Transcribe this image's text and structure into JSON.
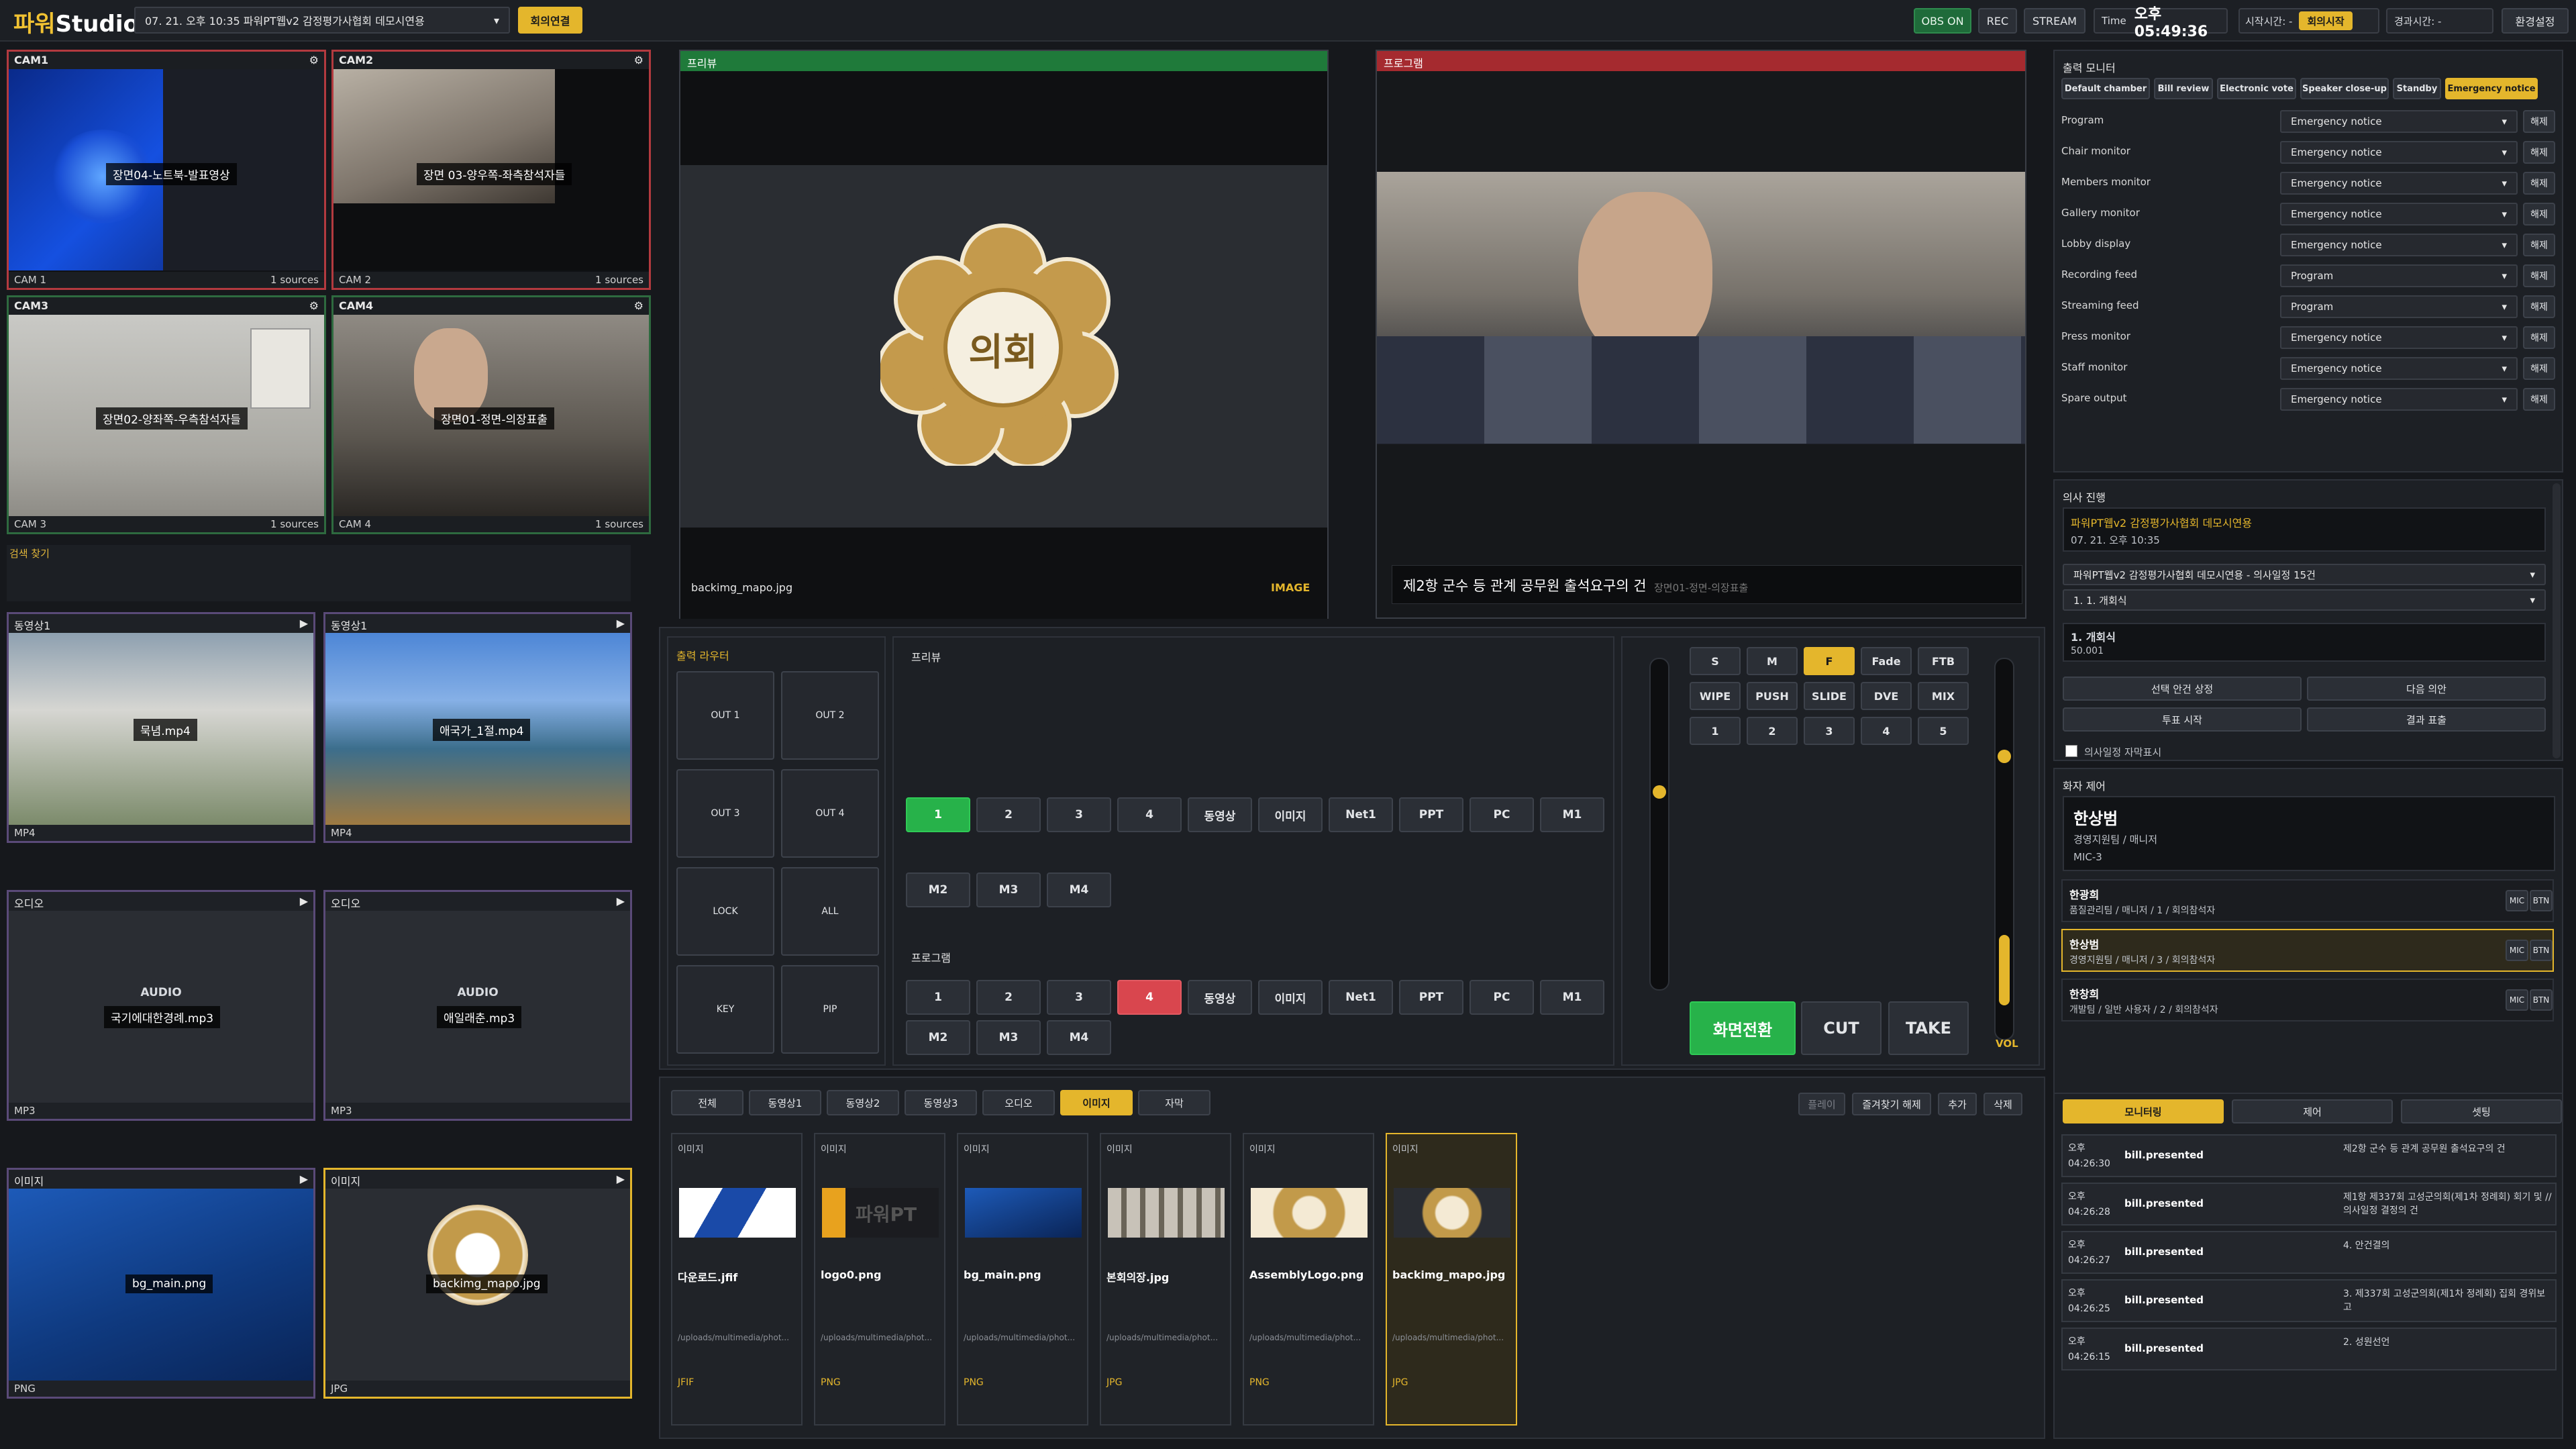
{
  "app": {
    "logo_a": "파워",
    "logo_b": "Studio"
  },
  "topbar": {
    "meeting_select": "07. 21. 오후 10:35 파워PT웹v2 감정평가사협회 데모시연용",
    "connect_button": "회의연결",
    "obs": "OBS ON",
    "rec": "REC",
    "stream": "STREAM",
    "time_label": "Time",
    "time_value": "오후 05:49:36",
    "start_label": "시작시간: -",
    "start_button": "회의시작",
    "elapsed": "경과시간: -",
    "settings": "환경설정"
  },
  "cams": [
    {
      "title": "CAM1",
      "label": "장면04-노트북-발표영상",
      "footer": "CAM 1",
      "sources": "1 sources"
    },
    {
      "title": "CAM2",
      "label": "장면 03-양우쪽-좌측참석자들",
      "footer": "CAM 2",
      "sources": "1 sources"
    },
    {
      "title": "CAM3",
      "label": "장면02-양좌쪽-우측참석자들",
      "footer": "CAM 3",
      "sources": "1 sources"
    },
    {
      "title": "CAM4",
      "label": "장면01-정면-의장표출",
      "footer": "CAM 4",
      "sources": "1 sources"
    }
  ],
  "search_label": "검색 찾기",
  "media_tiles": [
    {
      "head": "동영상1",
      "label": "묵념.mp4",
      "foot": "MP4"
    },
    {
      "head": "동영상1",
      "label": "애국가_1절.mp4",
      "foot": "MP4"
    },
    {
      "head": "오디오",
      "kind": "AUDIO",
      "label": "국기에대한경례.mp3",
      "foot": "MP3"
    },
    {
      "head": "오디오",
      "kind": "AUDIO",
      "label": "애일래춘.mp3",
      "foot": "MP3"
    },
    {
      "head": "이미지",
      "label": "bg_main.png",
      "foot": "PNG"
    },
    {
      "head": "이미지",
      "label": "backimg_mapo.jpg",
      "foot": "JPG"
    }
  ],
  "preview": {
    "title": "프리뷰",
    "emblem_text": "의회",
    "file": "backimg_mapo.jpg",
    "type": "IMAGE"
  },
  "program": {
    "title": "프로그램",
    "caption": "제2항 군수 등 관계 공무원 출석요구의 건",
    "subcaption": "장면01-정면-의장표출"
  },
  "router": {
    "title": "출력 라우터",
    "buttons": [
      "OUT 1",
      "OUT 2",
      "OUT 3",
      "OUT 4",
      "LOCK",
      "ALL",
      "KEY",
      "PIP"
    ]
  },
  "switcher": {
    "preview_label": "프리뷰",
    "program_label": "프로그램",
    "row1": [
      "1",
      "2",
      "3",
      "4",
      "동영상",
      "이미지",
      "Net1",
      "PPT",
      "PC",
      "M1"
    ],
    "row2": [
      "M2",
      "M3",
      "M4"
    ],
    "preview_active": "1",
    "program_active": "4"
  },
  "transition": {
    "row1": [
      "S",
      "M",
      "F",
      "Fade",
      "FTB"
    ],
    "row2": [
      "WIPE",
      "PUSH",
      "SLIDE",
      "DVE",
      "MIX"
    ],
    "row3": [
      "1",
      "2",
      "3",
      "4",
      "5"
    ],
    "active": "F",
    "switch": "화면전환",
    "cut": "CUT",
    "take": "TAKE",
    "vol": "VOL",
    "tbar_level": 0.6,
    "vol_level": 0.75
  },
  "library": {
    "tabs": [
      "전체",
      "동영상1",
      "동영상2",
      "동영상3",
      "오디오",
      "이미지",
      "자막"
    ],
    "active_tab": "이미지",
    "actions": [
      "플레이",
      "즐겨찾기 해제",
      "추가",
      "삭제"
    ],
    "items": [
      {
        "type": "이미지",
        "name": "다운로드.jfif",
        "path": "/uploads/multimedia/phot...",
        "ext": "JFIF"
      },
      {
        "type": "이미지",
        "name": "logo0.png",
        "path": "/uploads/multimedia/phot...",
        "ext": "PNG",
        "logo_text": "파워PT"
      },
      {
        "type": "이미지",
        "name": "bg_main.png",
        "path": "/uploads/multimedia/phot...",
        "ext": "PNG"
      },
      {
        "type": "이미지",
        "name": "본회의장.jpg",
        "path": "/uploads/multimedia/phot...",
        "ext": "JPG"
      },
      {
        "type": "이미지",
        "name": "AssemblyLogo.png",
        "path": "/uploads/multimedia/phot...",
        "ext": "PNG"
      },
      {
        "type": "이미지",
        "name": "backimg_mapo.jpg",
        "path": "/uploads/multimedia/phot...",
        "ext": "JPG"
      }
    ]
  },
  "output_monitor": {
    "title": "출력 모니터",
    "presets": [
      "Default chamber",
      "Bill review",
      "Electronic vote",
      "Speaker close-up",
      "Standby",
      "Emergency notice"
    ],
    "active_preset": "Emergency notice",
    "release": "해제",
    "rows": [
      {
        "name": "Program",
        "value": "Emergency notice"
      },
      {
        "name": "Chair monitor",
        "value": "Emergency notice"
      },
      {
        "name": "Members monitor",
        "value": "Emergency notice"
      },
      {
        "name": "Gallery monitor",
        "value": "Emergency notice"
      },
      {
        "name": "Lobby display",
        "value": "Emergency notice"
      },
      {
        "name": "Recording feed",
        "value": "Program"
      },
      {
        "name": "Streaming feed",
        "value": "Program"
      },
      {
        "name": "Press monitor",
        "value": "Emergency notice"
      },
      {
        "name": "Staff monitor",
        "value": "Emergency notice"
      },
      {
        "name": "Spare output",
        "value": "Emergency notice"
      }
    ]
  },
  "agenda": {
    "title": "의사 진행",
    "meeting_name": "파워PT웹v2 감정평가사협회 데모시연용",
    "meeting_date": "07. 21. 오후 10:35",
    "session_select": "파워PT웹v2 감정평가사협회 데모시연용 - 의사일정 15건",
    "item_select": "1. 1. 개회식",
    "current_title": "1. 개회식",
    "current_code": "50.001",
    "buttons": [
      "선택 안건 상정",
      "다음 의안",
      "투표 시작",
      "결과 표출"
    ],
    "checkbox_label": "의사일정 자막표시"
  },
  "speakers": {
    "title": "화자 제어",
    "main_name": "한상범",
    "main_role": "경영지원팀 / 매니저",
    "main_mic": "MIC-3",
    "mic": "MIC",
    "btn": "BTN",
    "list": [
      {
        "name": "한광희",
        "detail": "품질관리팀 / 매니저 / 1 / 회의참석자"
      },
      {
        "name": "한상범",
        "detail": "경영지원팀 / 매니저 / 3 / 회의참석자"
      },
      {
        "name": "한창희",
        "detail": "개발팀 / 일반 사용자 / 2 / 회의참석자"
      }
    ]
  },
  "log": {
    "tabs": [
      "모니터링",
      "제어",
      "셋팅"
    ],
    "active": "모니터링",
    "entries": [
      {
        "ampm": "오후",
        "time": "04:26:30",
        "event": "bill.presented",
        "text": "제2항 군수 등 관계 공무원 출석요구의 건"
      },
      {
        "ampm": "오후",
        "time": "04:26:28",
        "event": "bill.presented",
        "text": "제1항 제337회 고성군의회(제1차 정례회) 회기 및 // 의사일정 결정의 건"
      },
      {
        "ampm": "오후",
        "time": "04:26:27",
        "event": "bill.presented",
        "text": "4. 안건결의"
      },
      {
        "ampm": "오후",
        "time": "04:26:25",
        "event": "bill.presented",
        "text": "3. 제337회 고성군의회(제1차 정례회) 집회 경위보고"
      },
      {
        "ampm": "오후",
        "time": "04:26:15",
        "event": "bill.presented",
        "text": "2. 성원선언"
      }
    ]
  }
}
